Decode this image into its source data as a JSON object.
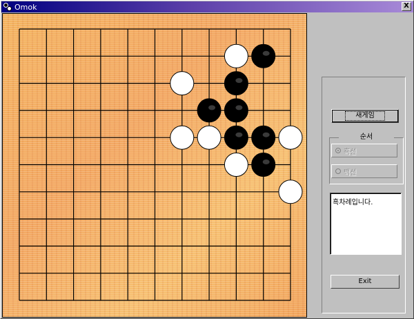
{
  "window": {
    "title": "Omok",
    "close_label": "X"
  },
  "board": {
    "size": 11,
    "cells": 10,
    "stones": [
      {
        "color": "white",
        "col": 8,
        "row": 1
      },
      {
        "color": "black",
        "col": 9,
        "row": 1
      },
      {
        "color": "white",
        "col": 6,
        "row": 2
      },
      {
        "color": "black",
        "col": 8,
        "row": 2
      },
      {
        "color": "black",
        "col": 7,
        "row": 3
      },
      {
        "color": "black",
        "col": 8,
        "row": 3
      },
      {
        "color": "white",
        "col": 6,
        "row": 4
      },
      {
        "color": "white",
        "col": 7,
        "row": 4
      },
      {
        "color": "black",
        "col": 8,
        "row": 4
      },
      {
        "color": "black",
        "col": 9,
        "row": 4
      },
      {
        "color": "white",
        "col": 10,
        "row": 4
      },
      {
        "color": "white",
        "col": 8,
        "row": 5
      },
      {
        "color": "black",
        "col": 9,
        "row": 5
      },
      {
        "color": "white",
        "col": 10,
        "row": 6
      }
    ],
    "colors": {
      "black_stone": "#000000",
      "white_stone": "#ffffff",
      "line": "#000000"
    }
  },
  "controls": {
    "new_game_label": "새게임",
    "order_group_label": "순서",
    "option_black": "흑선",
    "option_white": "백선",
    "status_text": "흑차례입니다.",
    "exit_label": "Exit"
  }
}
